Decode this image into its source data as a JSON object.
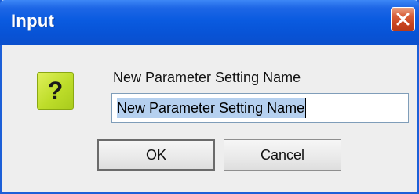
{
  "window": {
    "title": "Input",
    "close_icon": "close-icon"
  },
  "dialog": {
    "icon": "question-icon",
    "icon_glyph": "?",
    "prompt": "New Parameter Setting Name",
    "input_value": "New Parameter Setting Name"
  },
  "buttons": {
    "ok_label": "OK",
    "cancel_label": "Cancel"
  },
  "colors": {
    "titlebar": "#0a5be0",
    "close_button": "#d9603a",
    "icon_background": "#bedd2a",
    "selection": "#b5d0ef",
    "dialog_background": "#eeeeee"
  }
}
